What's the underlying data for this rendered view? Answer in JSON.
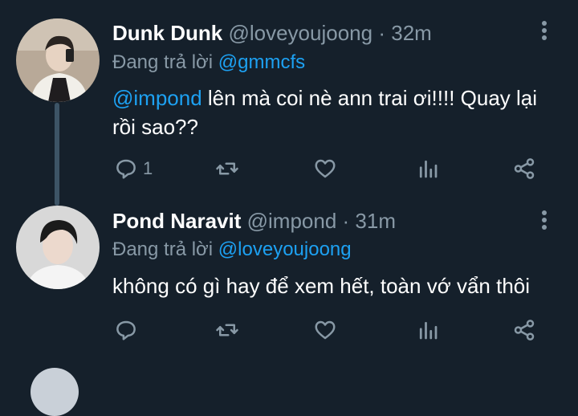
{
  "tweets": [
    {
      "name": "Dunk Dunk",
      "handle": "@loveyoujoong",
      "dot": "·",
      "time": "32m",
      "reply_prefix": "Đang trả lời",
      "reply_to": "@gmmcfs",
      "mention": "@impond",
      "text": " lên mà coi nè ann trai ơi!!!! Quay lại rồi sao??",
      "reply_count": "1"
    },
    {
      "name": "Pond Naravit",
      "handle": "@impond",
      "dot": "·",
      "time": "31m",
      "reply_prefix": "Đang trả lời",
      "reply_to": "@loveyoujoong",
      "text": "không có gì hay để xem hết, toàn vớ vẩn thôi"
    }
  ],
  "icons": {
    "reply": "reply-icon",
    "retweet": "retweet-icon",
    "like": "like-icon",
    "stats": "stats-icon",
    "share": "share-icon",
    "more": "more-vertical-icon"
  },
  "colors": {
    "background": "#15202b",
    "text": "#ffffff",
    "muted": "#8899a6",
    "link": "#1da1f2",
    "thread_line": "#3d5466"
  }
}
